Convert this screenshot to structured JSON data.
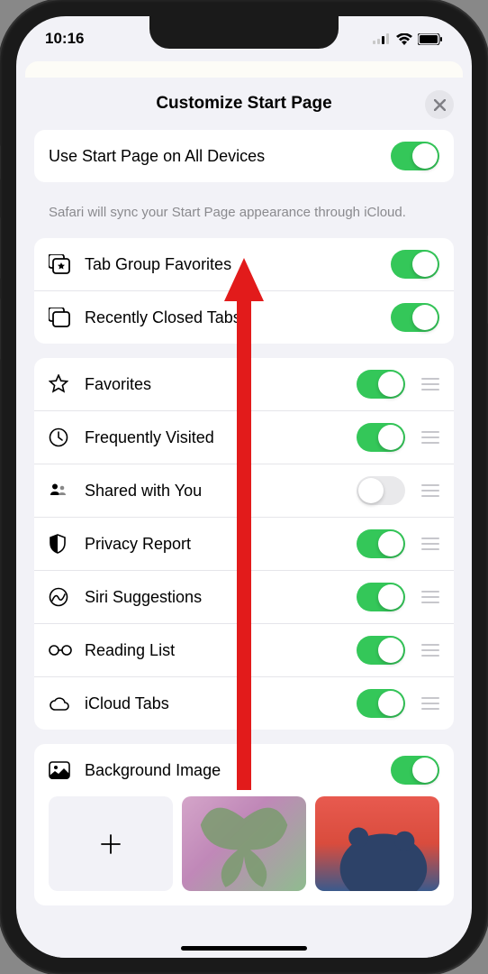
{
  "status": {
    "time": "10:16"
  },
  "sheet": {
    "title": "Customize Start Page"
  },
  "sync": {
    "label": "Use Start Page on All Devices",
    "enabled": true,
    "hint": "Safari will sync your Start Page appearance through iCloud."
  },
  "section2": [
    {
      "icon": "tab-group-favorites",
      "label": "Tab Group Favorites",
      "enabled": true
    },
    {
      "icon": "recently-closed",
      "label": "Recently Closed Tabs",
      "enabled": true
    }
  ],
  "section3": [
    {
      "icon": "star",
      "label": "Favorites",
      "enabled": true,
      "reorder": true
    },
    {
      "icon": "clock",
      "label": "Frequently Visited",
      "enabled": true,
      "reorder": true
    },
    {
      "icon": "shared",
      "label": "Shared with You",
      "enabled": false,
      "reorder": true
    },
    {
      "icon": "shield",
      "label": "Privacy Report",
      "enabled": true,
      "reorder": true
    },
    {
      "icon": "siri",
      "label": "Siri Suggestions",
      "enabled": true,
      "reorder": true
    },
    {
      "icon": "glasses",
      "label": "Reading List",
      "enabled": true,
      "reorder": true
    },
    {
      "icon": "cloud",
      "label": "iCloud Tabs",
      "enabled": true,
      "reorder": true
    }
  ],
  "background": {
    "label": "Background Image",
    "enabled": true
  }
}
